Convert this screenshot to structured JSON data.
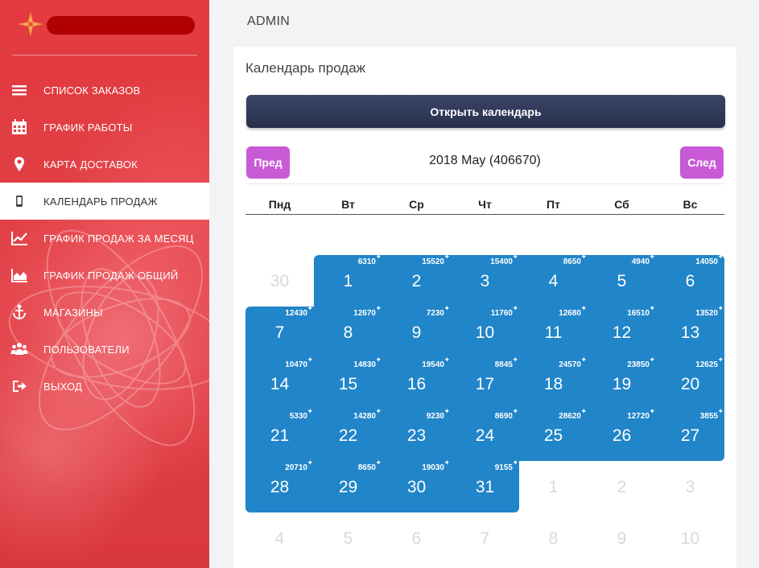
{
  "header": {
    "title": "ADMIN"
  },
  "colors": {
    "sidebar": "#e03a40",
    "accent_blue": "#2185c9",
    "nav_button": "#c85ad6",
    "open_button": "#2f3754",
    "brand_pill": "#b00000"
  },
  "sidebar": {
    "items": [
      {
        "label": "СПИСОК ЗАКАЗОВ",
        "icon": "list-icon"
      },
      {
        "label": "ГРАФИК РАБОТЫ",
        "icon": "calendar-icon"
      },
      {
        "label": "КАРТА ДОСТАВОК",
        "icon": "map-marker-icon"
      },
      {
        "label": "КАЛЕНДАРЬ ПРОДАЖ",
        "icon": "mobile-icon",
        "active": true
      },
      {
        "label": "ГРАФИК ПРОДАЖ ЗА МЕСЯЦ",
        "icon": "line-chart-icon"
      },
      {
        "label": "ГРАФИК ПРОДАЖ ОБЩИЙ",
        "icon": "area-chart-icon"
      },
      {
        "label": "МАГАЗИНЫ",
        "icon": "anchor-icon"
      },
      {
        "label": "ПОЛЬЗОВАТЕЛИ",
        "icon": "users-icon"
      },
      {
        "label": "ВЫХОД",
        "icon": "sign-out-icon"
      }
    ]
  },
  "calendar": {
    "title": "Календарь продаж",
    "open_button": "Открыть календарь",
    "prev": "Пред",
    "next": "След",
    "month_label": "2018 May (406670)",
    "weekdays": [
      "Пнд",
      "Вт",
      "Ср",
      "Чт",
      "Пт",
      "Сб",
      "Вс"
    ],
    "weeks": [
      [
        {
          "day": "30",
          "muted": true
        },
        {
          "day": "1",
          "amount": "6310"
        },
        {
          "day": "2",
          "amount": "15520"
        },
        {
          "day": "3",
          "amount": "15400"
        },
        {
          "day": "4",
          "amount": "8650"
        },
        {
          "day": "5",
          "amount": "4940"
        },
        {
          "day": "6",
          "amount": "14050"
        }
      ],
      [
        {
          "day": "7",
          "amount": "12430"
        },
        {
          "day": "8",
          "amount": "12670"
        },
        {
          "day": "9",
          "amount": "7230"
        },
        {
          "day": "10",
          "amount": "11760"
        },
        {
          "day": "11",
          "amount": "12680"
        },
        {
          "day": "12",
          "amount": "16510"
        },
        {
          "day": "13",
          "amount": "13520"
        }
      ],
      [
        {
          "day": "14",
          "amount": "10470"
        },
        {
          "day": "15",
          "amount": "14830"
        },
        {
          "day": "16",
          "amount": "19540"
        },
        {
          "day": "17",
          "amount": "8845"
        },
        {
          "day": "18",
          "amount": "24570"
        },
        {
          "day": "19",
          "amount": "23850"
        },
        {
          "day": "20",
          "amount": "12625"
        }
      ],
      [
        {
          "day": "21",
          "amount": "5330"
        },
        {
          "day": "22",
          "amount": "14280"
        },
        {
          "day": "23",
          "amount": "9230"
        },
        {
          "day": "24",
          "amount": "8690"
        },
        {
          "day": "25",
          "amount": "28620"
        },
        {
          "day": "26",
          "amount": "12720"
        },
        {
          "day": "27",
          "amount": "3855"
        }
      ],
      [
        {
          "day": "28",
          "amount": "20710"
        },
        {
          "day": "29",
          "amount": "8650"
        },
        {
          "day": "30",
          "amount": "19030"
        },
        {
          "day": "31",
          "amount": "9155"
        },
        {
          "day": "1",
          "muted": true
        },
        {
          "day": "2",
          "muted": true
        },
        {
          "day": "3",
          "muted": true
        }
      ],
      [
        {
          "day": "4",
          "muted": true
        },
        {
          "day": "5",
          "muted": true
        },
        {
          "day": "6",
          "muted": true
        },
        {
          "day": "7",
          "muted": true
        },
        {
          "day": "8",
          "muted": true
        },
        {
          "day": "9",
          "muted": true
        },
        {
          "day": "10",
          "muted": true
        }
      ]
    ]
  }
}
